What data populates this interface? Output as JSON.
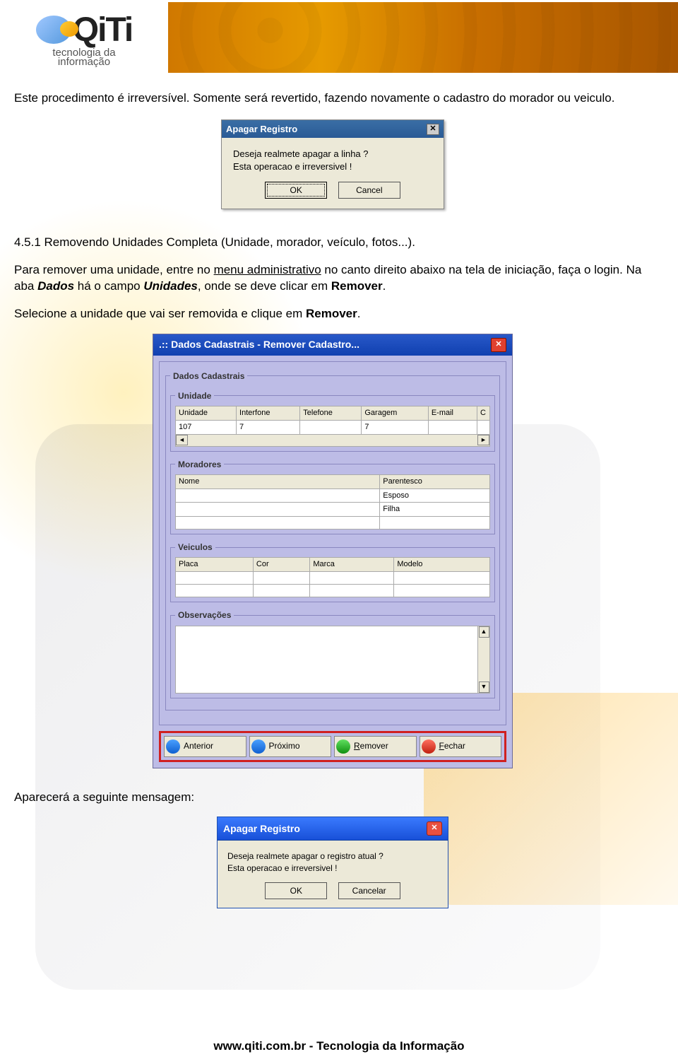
{
  "logo": {
    "brand": "QiTi",
    "sub1": "tecnologia da",
    "sub2": "informação"
  },
  "para1": "Este procedimento é irreversível. Somente será revertido, fazendo novamente o cadastro do morador ou veiculo.",
  "section_heading": "4.5.1 Removendo Unidades Completa (Unidade, morador, veículo, fotos...).",
  "para2a": "Para remover uma unidade, entre no ",
  "para2_link": "menu administrativo",
  "para2b": " no canto direito abaixo na tela de iniciação, faça o login. Na aba ",
  "para2_dados": "Dados",
  "para2c": " há o campo ",
  "para2_unidades": "Unidades",
  "para2d": ", onde se deve clicar em ",
  "para2_remover": "Remover",
  "para2e": ".",
  "para3a": "Selecione a unidade que vai ser removida e clique em ",
  "para3_remover": "Remover",
  "para3b": ".",
  "para4": "Aparecerá a seguinte mensagem:",
  "dlg1": {
    "title": "Apagar Registro",
    "line1": "Deseja realmete apagar a linha ?",
    "line2": "Esta operacao e irreversivel !",
    "ok": "OK",
    "cancel": "Cancel"
  },
  "dlg2": {
    "title": ".:: Dados Cadastrais - Remover Cadastro...",
    "group_main": "Dados Cadastrais",
    "group_unidade": "Unidade",
    "unidade_cols": [
      "Unidade",
      "Interfone",
      "Telefone",
      "Garagem",
      "E-mail",
      "C"
    ],
    "unidade_row": [
      "107",
      "7",
      "",
      "7",
      "",
      ""
    ],
    "group_moradores": "Moradores",
    "moradores_cols": [
      "Nome",
      "Parentesco"
    ],
    "moradores_rows": [
      [
        "",
        "Esposo"
      ],
      [
        "",
        "Filha"
      ]
    ],
    "group_veiculos": "Veiculos",
    "veiculos_cols": [
      "Placa",
      "Cor",
      "Marca",
      "Modelo"
    ],
    "group_obs": "Observações",
    "btn_anterior": "Anterior",
    "btn_proximo": "Próximo",
    "btn_remover": "Remover",
    "btn_fechar": "Fechar"
  },
  "dlg3": {
    "title": "Apagar Registro",
    "line1": "Deseja realmete apagar o registro atual ?",
    "line2": "Esta operacao e irreversivel !",
    "ok": "OK",
    "cancel": "Cancelar"
  },
  "footer": "www.qiti.com.br - Tecnologia da Informação"
}
